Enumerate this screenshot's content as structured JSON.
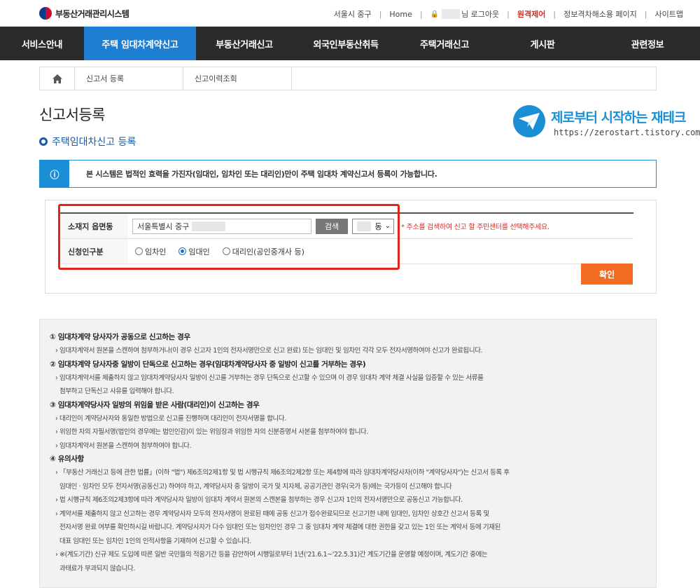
{
  "header": {
    "logo_text": "부동산거래관리시스템",
    "region": "서울시 중구",
    "home_link": "Home",
    "user_suffix": "님 로그아웃",
    "remote_control": "원격제어",
    "privacy": "정보격차해소용 페이지",
    "sitemap": "사이트맵"
  },
  "nav": {
    "items": [
      {
        "label": "서비스안내"
      },
      {
        "label": "주택 임대차계약신고",
        "active": true
      },
      {
        "label": "부동산거래신고"
      },
      {
        "label": "외국인부동산취득"
      },
      {
        "label": "주택거래신고"
      },
      {
        "label": "게시판"
      },
      {
        "label": "관련정보"
      }
    ]
  },
  "subtabs": {
    "register": "신고서 등록",
    "history": "신고이력조회"
  },
  "page": {
    "title": "신고서등록",
    "section": "주택임대차신고 등록"
  },
  "watermark": {
    "title": "제로부터 시작하는 재테크",
    "url": "https://zerostart.tistory.com/"
  },
  "info": {
    "icon": "ⓘ",
    "text": "본 시스템은 법적인 효력을 가진자(임대인, 임차인 또는 대리인)만이 주택 임대차 계약신고서 등록이 가능합니다."
  },
  "form": {
    "address_label": "소재지 읍면동",
    "address_value": "서울특별시 중구",
    "search_button": "검색",
    "dong_suffix": "동",
    "address_hint": "주소를 검색하여 신고 할 주민센터를 선택해주세요.",
    "applicant_label": "신청인구분",
    "applicant_options": [
      {
        "label": "임차인",
        "checked": false
      },
      {
        "label": "임대인",
        "checked": true
      },
      {
        "label": "대리인(공인중개사 등)",
        "checked": false
      }
    ],
    "confirm_button": "확인"
  },
  "notes": {
    "s1_title": "① 임대차계약 당사자가 공동으로 신고하는 경우",
    "s1_l1": "› 임대차계약서 원본을 스캔하여 첨부하거나(이 경우 신고자 1인의 전자서명만으로 신고 완료) 또는 임대인 및 임차인 각각 모두 전자서명하여야 신고가 완료됩니다.",
    "s2_title": "② 임대차계약 당사자중 일방이 단독으로 신고하는 경우(임대차계약당사자 중 일방이 신고를 거부하는 경우)",
    "s2_l1": "› 임대차계약서를 제출하지 않고 임대차계약당사자 일방이 신고를 거부하는 경우 단독으로 신고할 수 있으며 이 경우 임대차 계약 체결 사실을 입증할 수 있는 서류를",
    "s2_l2": "첨부하고 단독신고 사유를 입력해야 합니다.",
    "s3_title": "③ 임대차계약당사자 일방의 위임을 받은 사람(대리인)이 신고하는 경우",
    "s3_l1": "› 대리인이 계약당사자와 동일한 방법으로 신고를 진행하며 대리인이 전자서명을 합니다.",
    "s3_l2": "› 위임한 자의 자필서명(법인의 경우에는 법인인감)이 있는 위임장과 위임한 자의 신분증명서 사본을 첨부하여야 합니다.",
    "s3_l3": "› 임대차계약서 원본을 스캔하여 첨부하여야 합니다.",
    "s4_title": "④ 유의사항",
    "s4_l1": "› 「부동산 거래신고 등에 관한 법률」(이하 \"법\") 제6조의2제1항 및 법 시행규칙 제6조의2제2항 또는 제4항에 따라 임대차계약당사자(이하 \"계약당사자\")는 신고서 등록 후",
    "s4_l2": "임대인 · 임차인 모두 전자서명(공동신고) 하여야 하고, 계약당사자 중 일방이 국가 및 지자체, 공공기관인 경우(국가 등)에는 국가등이 신고해야 합니다",
    "s4_l3": "› 법 시행규칙 제6조의2제3항에 따라 계약당사자 일방이 임대차 계약서 원본의 스캔본을 첨부하는 경우 신고자 1인의 전자서명만으로 공동신고 가능합니다.",
    "s4_l4": "› 계약서를 제출하지 않고 신고하는 경우 계약당사자 모두의 전자서명이 완료된 때에 공동 신고가 접수완료되므로 신고기한 내에 임대인, 임차인 상호간 신고서 등록 및",
    "s4_l5": "전자서명 완료 여부를 확인하시길 바랍니다. 계약당사자가 다수 임대인 또는 임차인인 경우 그 중 임대차 계약 체결에 대한 권한을 갖고 있는 1인 또는 계약서 등에 기재된",
    "s4_l6": "대표 임대인 또는 임차인 1인의 인적사항을 기재하여 신고할 수 있습니다.",
    "s4_l7": "› ※(계도기간) 신규 제도 도입에 따른 일반 국민들의 적응기간 등을 감안하여 시행일로부터 1년('21.6.1~'22.5.31)간 계도기간을 운영할 예정이며, 계도기간 중에는",
    "s4_l8": "과태료가 부과되지 않습니다."
  },
  "colors": {
    "nav_bg": "#2b2b2b",
    "nav_active": "#1d7ed2",
    "info_accent": "#1b8fd6",
    "confirm_button": "#f26c21",
    "highlight_box": "#e0261a"
  }
}
